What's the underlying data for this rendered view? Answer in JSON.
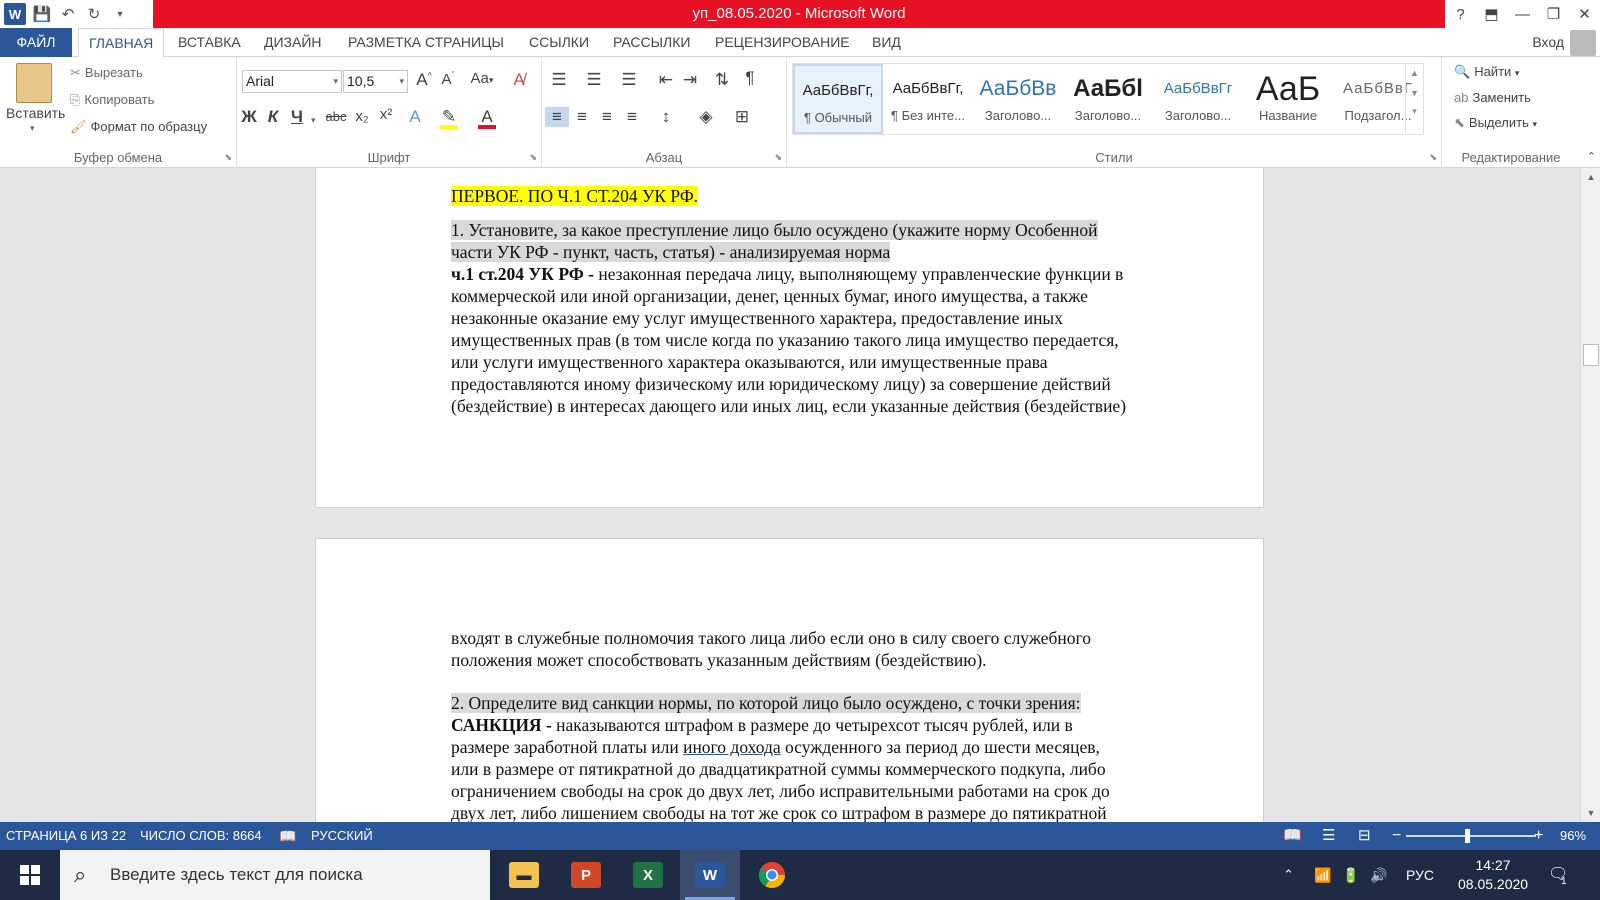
{
  "title_bar": {
    "title": "уп_08.05.2020 -  Microsoft Word",
    "help": "?",
    "icons": [
      "word-logo-icon",
      "save-icon",
      "undo-icon",
      "redo-icon",
      "customize-qat-icon"
    ]
  },
  "tabs": {
    "file": "ФАЙЛ",
    "items": [
      "ГЛАВНАЯ",
      "ВСТАВКА",
      "ДИЗАЙН",
      "РАЗМЕТКА СТРАНИЦЫ",
      "ССЫЛКИ",
      "РАССЫЛКИ",
      "РЕЦЕНЗИРОВАНИЕ",
      "ВИД"
    ],
    "active": "ГЛАВНАЯ",
    "signin": "Вход"
  },
  "ribbon": {
    "clipboard": {
      "paste": "Вставить",
      "cut": "Вырезать",
      "copy": "Копировать",
      "format_painter": "Формат по образцу",
      "label": "Буфер обмена"
    },
    "font": {
      "font_name": "Arial",
      "font_size": "10,5",
      "label": "Шрифт",
      "bold": "Ж",
      "italic": "К",
      "underline": "Ч",
      "strike": "abc",
      "subscript": "x₂",
      "superscript": "x²",
      "grow": "A",
      "shrink": "A",
      "case": "Aa",
      "highlight_color": "#ffff00",
      "font_color": "#e81123"
    },
    "paragraph": {
      "label": "Абзац",
      "pilcrow": "¶"
    },
    "styles": {
      "label": "Стили",
      "items": [
        {
          "preview": "АаБбВвГг,",
          "name": "¶ Обычный"
        },
        {
          "preview": "АаБбВвГг,",
          "name": "¶ Без инте..."
        },
        {
          "preview": "АаБбВв",
          "name": "Заголово..."
        },
        {
          "preview": "АаБбl",
          "name": "Заголово..."
        },
        {
          "preview": "АаБбВвГг",
          "name": "Заголово..."
        },
        {
          "preview": "АаБ",
          "name": "Название"
        },
        {
          "preview": "АаБбВвГ",
          "name": "Подзагол..."
        }
      ],
      "selected_index": 0,
      "heading_color": "#2e74b5"
    },
    "editing": {
      "label": "Редактирование",
      "find": "Найти",
      "replace": "Заменить",
      "select": "Выделить"
    }
  },
  "document": {
    "page1_lines": [
      {
        "text": "ПЕРВОЕ. ПО Ч.1 СТ.204 УК РФ.",
        "style": "hlY"
      },
      {
        "text": "1. Установите, за какое преступление лицо было осуждено (укажите норму Особенной",
        "style": "hlG"
      },
      {
        "text": "части УК РФ - пункт, часть, статья) - анализируемая норма",
        "style": "hlG"
      },
      {
        "bold": "ч.1 ст.204 УК РФ -",
        "text": " незаконная передача лицу, выполняющему управленческие функции в"
      },
      {
        "text": "коммерческой или иной организации, денег, ценных бумаг, иного имущества, а также"
      },
      {
        "text": "незаконные оказание ему услуг имущественного характера, предоставление иных"
      },
      {
        "text": "имущественных прав (в том числе когда по указанию такого лица имущество передается,"
      },
      {
        "text": "или услуги имущественного характера оказываются, или имущественные права"
      },
      {
        "text": "предоставляются иному физическому или юридическому лицу) за совершение действий"
      },
      {
        "text": "(бездействие) в интересах дающего или иных лиц, если указанные действия (бездействие)"
      }
    ],
    "page2_lines": [
      {
        "text": "входят в служебные полномочия такого лица либо если оно в силу своего служебного"
      },
      {
        "text": "положения может способствовать указанным действиям (бездействию)."
      },
      {
        "text": "2. Определите вид санкции нормы, по которой лицо было осуждено, с точки зрения:",
        "style": "hlG"
      },
      {
        "bold": "САНКЦИЯ -",
        "text": " наказываются штрафом в размере до четырехсот тысяч рублей, или в"
      },
      {
        "text": "размере заработной платы или ",
        "ul": "иного дохода",
        "text2": " осужденного за период до шести месяцев,"
      },
      {
        "text": "или в размере от пятикратной до двадцатикратной суммы коммерческого подкупа, либо"
      },
      {
        "text": "ограничением свободы на срок до двух лет, либо исправительными работами на срок до"
      },
      {
        "text": "двух лет, либо лишением свободы на тот же срок со штрафом в размере до пятикратной"
      }
    ]
  },
  "status": {
    "page": "СТРАНИЦА 6 ИЗ 22",
    "words": "ЧИСЛО СЛОВ: 8664",
    "language": "РУССКИЙ",
    "zoom": "96%",
    "zoom_value": 96
  },
  "taskbar": {
    "search_placeholder": "Введите здесь текст для поиска",
    "apps": [
      "file-explorer-icon",
      "powerpoint-icon",
      "excel-icon",
      "word-icon",
      "chrome-icon"
    ],
    "active_app": "word-icon",
    "lang": "РУС",
    "time": "14:27",
    "date": "08.05.2020",
    "notifications": "1"
  }
}
